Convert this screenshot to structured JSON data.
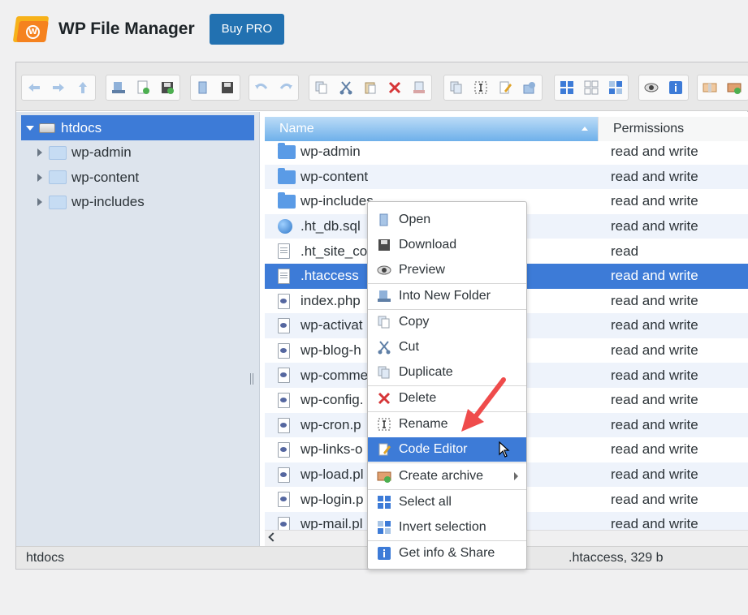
{
  "header": {
    "title": "WP File Manager",
    "buy_pro_label": "Buy PRO"
  },
  "toolbar": {
    "groups": [
      [
        "back-icon",
        "forward-icon",
        "up-icon"
      ],
      [
        "network-drive-icon",
        "new-file-icon",
        "save-icon"
      ],
      [
        "open-icon",
        "save-as-icon"
      ],
      [
        "undo-icon",
        "redo-icon"
      ],
      [
        "copy-icon",
        "cut-icon",
        "paste-icon",
        "delete-icon",
        "empty-icon"
      ],
      [
        "duplicate-icon",
        "rename-icon",
        "edit-icon",
        "resize-icon"
      ],
      [
        "icons-view-icon",
        "list-view-icon",
        "small-icons-view-icon"
      ],
      [
        "preview-icon",
        "info-icon"
      ],
      [
        "extract-icon",
        "archive-icon"
      ]
    ],
    "accent": "#3d7bd7"
  },
  "tree": {
    "root": "htdocs",
    "items": [
      "wp-admin",
      "wp-content",
      "wp-includes"
    ]
  },
  "filelist": {
    "columns": {
      "name": "Name",
      "permissions": "Permissions"
    },
    "rows": [
      {
        "name": "wp-admin",
        "icon": "folder-icon",
        "perm": "read and write"
      },
      {
        "name": "wp-content",
        "icon": "folder-icon",
        "perm": "read and write"
      },
      {
        "name": "wp-includes",
        "icon": "folder-icon",
        "perm": "read and write"
      },
      {
        "name": ".ht_db.sql",
        "icon": "globe-file-icon",
        "perm": "read and write"
      },
      {
        "name": ".ht_site_co",
        "icon": "text-file-icon",
        "perm": "read"
      },
      {
        "name": ".htaccess",
        "icon": "text-file-icon",
        "perm": "read and write",
        "selected": true
      },
      {
        "name": "index.php",
        "icon": "php-file-icon",
        "perm": "read and write"
      },
      {
        "name": "wp-activat",
        "icon": "php-file-icon",
        "perm": "read and write"
      },
      {
        "name": "wp-blog-h",
        "icon": "php-file-icon",
        "perm": "read and write"
      },
      {
        "name": "wp-comme",
        "icon": "php-file-icon",
        "perm": "read and write"
      },
      {
        "name": "wp-config.",
        "icon": "php-file-icon",
        "perm": "read and write"
      },
      {
        "name": "wp-cron.p",
        "icon": "php-file-icon",
        "perm": "read and write"
      },
      {
        "name": "wp-links-o",
        "icon": "php-file-icon",
        "perm": "read and write"
      },
      {
        "name": "wp-load.pl",
        "icon": "php-file-icon",
        "perm": "read and write"
      },
      {
        "name": "wp-login.p",
        "icon": "php-file-icon",
        "perm": "read and write"
      },
      {
        "name": "wp-mail.pl",
        "icon": "php-file-icon",
        "perm": "read and write"
      }
    ]
  },
  "statusbar": {
    "path": "htdocs",
    "info": ".htaccess, 329 b"
  },
  "context_menu": {
    "items": [
      {
        "label": "Open",
        "icon": "open-icon"
      },
      {
        "label": "Download",
        "icon": "download-icon"
      },
      {
        "label": "Preview",
        "icon": "preview-icon"
      },
      {
        "label": "Into New Folder",
        "icon": "new-folder-icon"
      },
      {
        "label": "Copy",
        "icon": "copy-icon"
      },
      {
        "label": "Cut",
        "icon": "cut-icon"
      },
      {
        "label": "Duplicate",
        "icon": "duplicate-icon"
      },
      {
        "label": "Delete",
        "icon": "delete-icon"
      },
      {
        "label": "Rename",
        "icon": "rename-icon"
      },
      {
        "label": "Code Editor",
        "icon": "code-editor-icon",
        "highlighted": true
      },
      {
        "label": "Create archive",
        "icon": "archive-icon",
        "submenu": true
      },
      {
        "label": "Select all",
        "icon": "select-all-icon"
      },
      {
        "label": "Invert selection",
        "icon": "invert-selection-icon"
      },
      {
        "label": "Get info & Share",
        "icon": "info-icon"
      }
    ]
  }
}
